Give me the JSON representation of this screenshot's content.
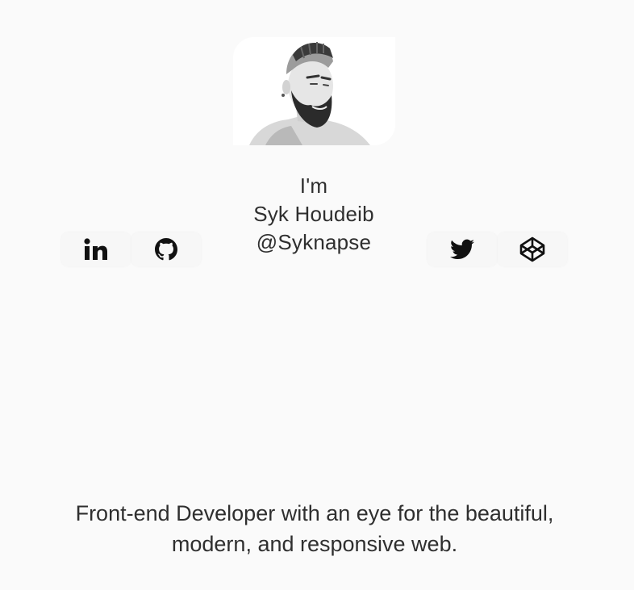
{
  "profile": {
    "photo_alt": "Portrait of Syk Houdeib",
    "intro_line": "I'm",
    "name": "Syk Houdeib",
    "handle": "@Syknapse"
  },
  "social_links": [
    {
      "icon": "linkedin-icon",
      "label": "LinkedIn"
    },
    {
      "icon": "github-icon",
      "label": "GitHub"
    },
    {
      "icon": "twitter-icon",
      "label": "Twitter"
    },
    {
      "icon": "codepen-icon",
      "label": "CodePen"
    }
  ],
  "bio": {
    "line1": "Front-end Developer with an eye for the beautiful,",
    "line2": "modern, and responsive web."
  },
  "colors": {
    "background": "#fafafa",
    "text": "#2f2f2f",
    "icon": "#111111"
  }
}
